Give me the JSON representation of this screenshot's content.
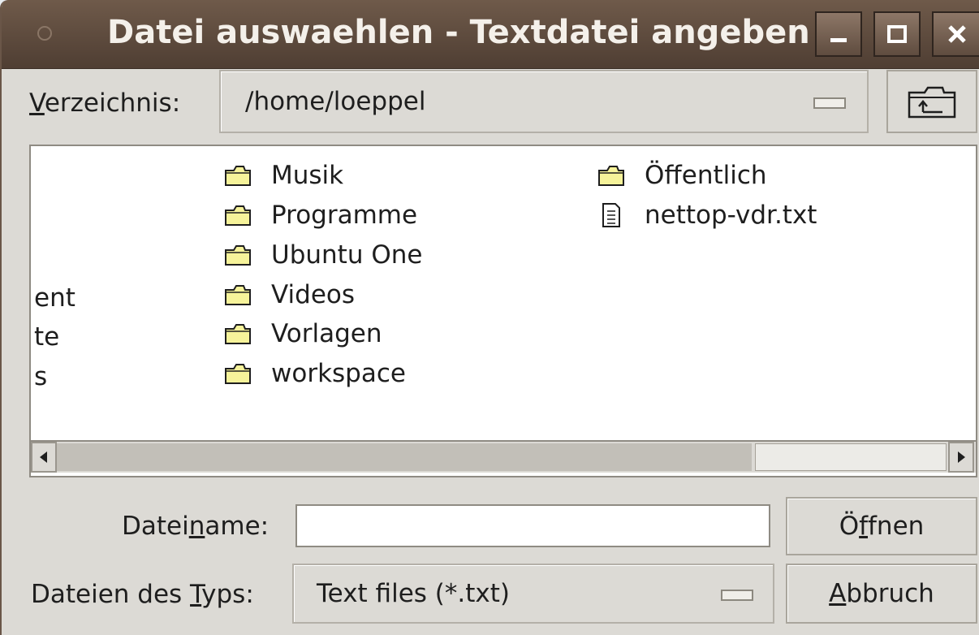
{
  "window": {
    "title": "Datei auswaehlen - Textdatei angeben",
    "colors": {
      "titlebar": "#5f4b3e",
      "title_text": "#f4f0ea",
      "folder": "#f6f39a"
    }
  },
  "directory": {
    "label_first": "V",
    "label_rest": "erzeichnis:",
    "path": "/home/loeppel",
    "up_icon": "folder-up-icon"
  },
  "files": {
    "truncated": [
      "ent",
      "te",
      "s"
    ],
    "column2": [
      "Musik",
      "Programme",
      "Ubuntu One",
      "Videos",
      "Vorlagen",
      "workspace"
    ],
    "column3": [
      {
        "name": "Öffentlich",
        "type": "folder"
      },
      {
        "name": "nettop-vdr.txt",
        "type": "file"
      }
    ]
  },
  "filename": {
    "label_pre": "Datei",
    "label_u": "n",
    "label_post": "ame:",
    "value": ""
  },
  "filetype": {
    "label_pre": "Dateien des ",
    "label_u": "T",
    "label_post": "yps:",
    "selected": "Text files (*.txt)"
  },
  "buttons": {
    "open_pre": "Ö",
    "open_u": "f",
    "open_post": "fnen",
    "cancel_u": "A",
    "cancel_post": "bbruch"
  }
}
